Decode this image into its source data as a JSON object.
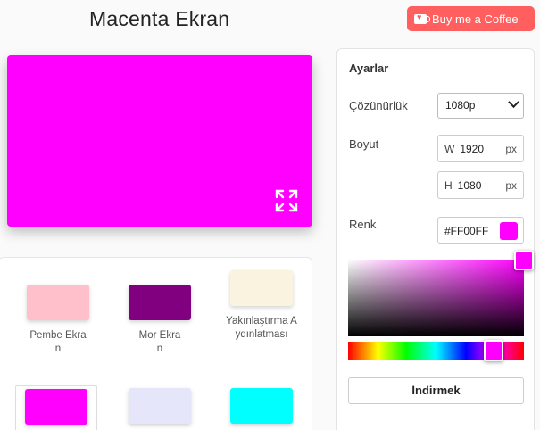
{
  "header": {
    "title": "Macenta Ekran",
    "coffee_label": "Buy me a Coffee"
  },
  "preview": {
    "color": "#FF00FF"
  },
  "swatches": [
    {
      "label": "Pembe Ekran",
      "color": "#FFC0CB"
    },
    {
      "label": "Mor Ekran",
      "color": "#800080"
    },
    {
      "label": "Yakınlaştırma Aydınlatması",
      "color": "#FAF3E0"
    },
    {
      "label": "",
      "color": "#FF00FF"
    },
    {
      "label": "",
      "color": "#E6E6FA"
    },
    {
      "label": "",
      "color": "#00FFFF"
    }
  ],
  "settings": {
    "title": "Ayarlar",
    "resolution_label": "Çözünürlük",
    "resolution_value": "1080p",
    "size_label": "Boyut",
    "width_prefix": "W",
    "width_value": "1920",
    "height_prefix": "H",
    "height_value": "1080",
    "unit": "px",
    "color_label": "Renk",
    "hex_value": "#FF00FF",
    "download_label": "İndirmek"
  },
  "colors": {
    "coffee": "#FF5F5F",
    "accent": "#FF00FF"
  }
}
